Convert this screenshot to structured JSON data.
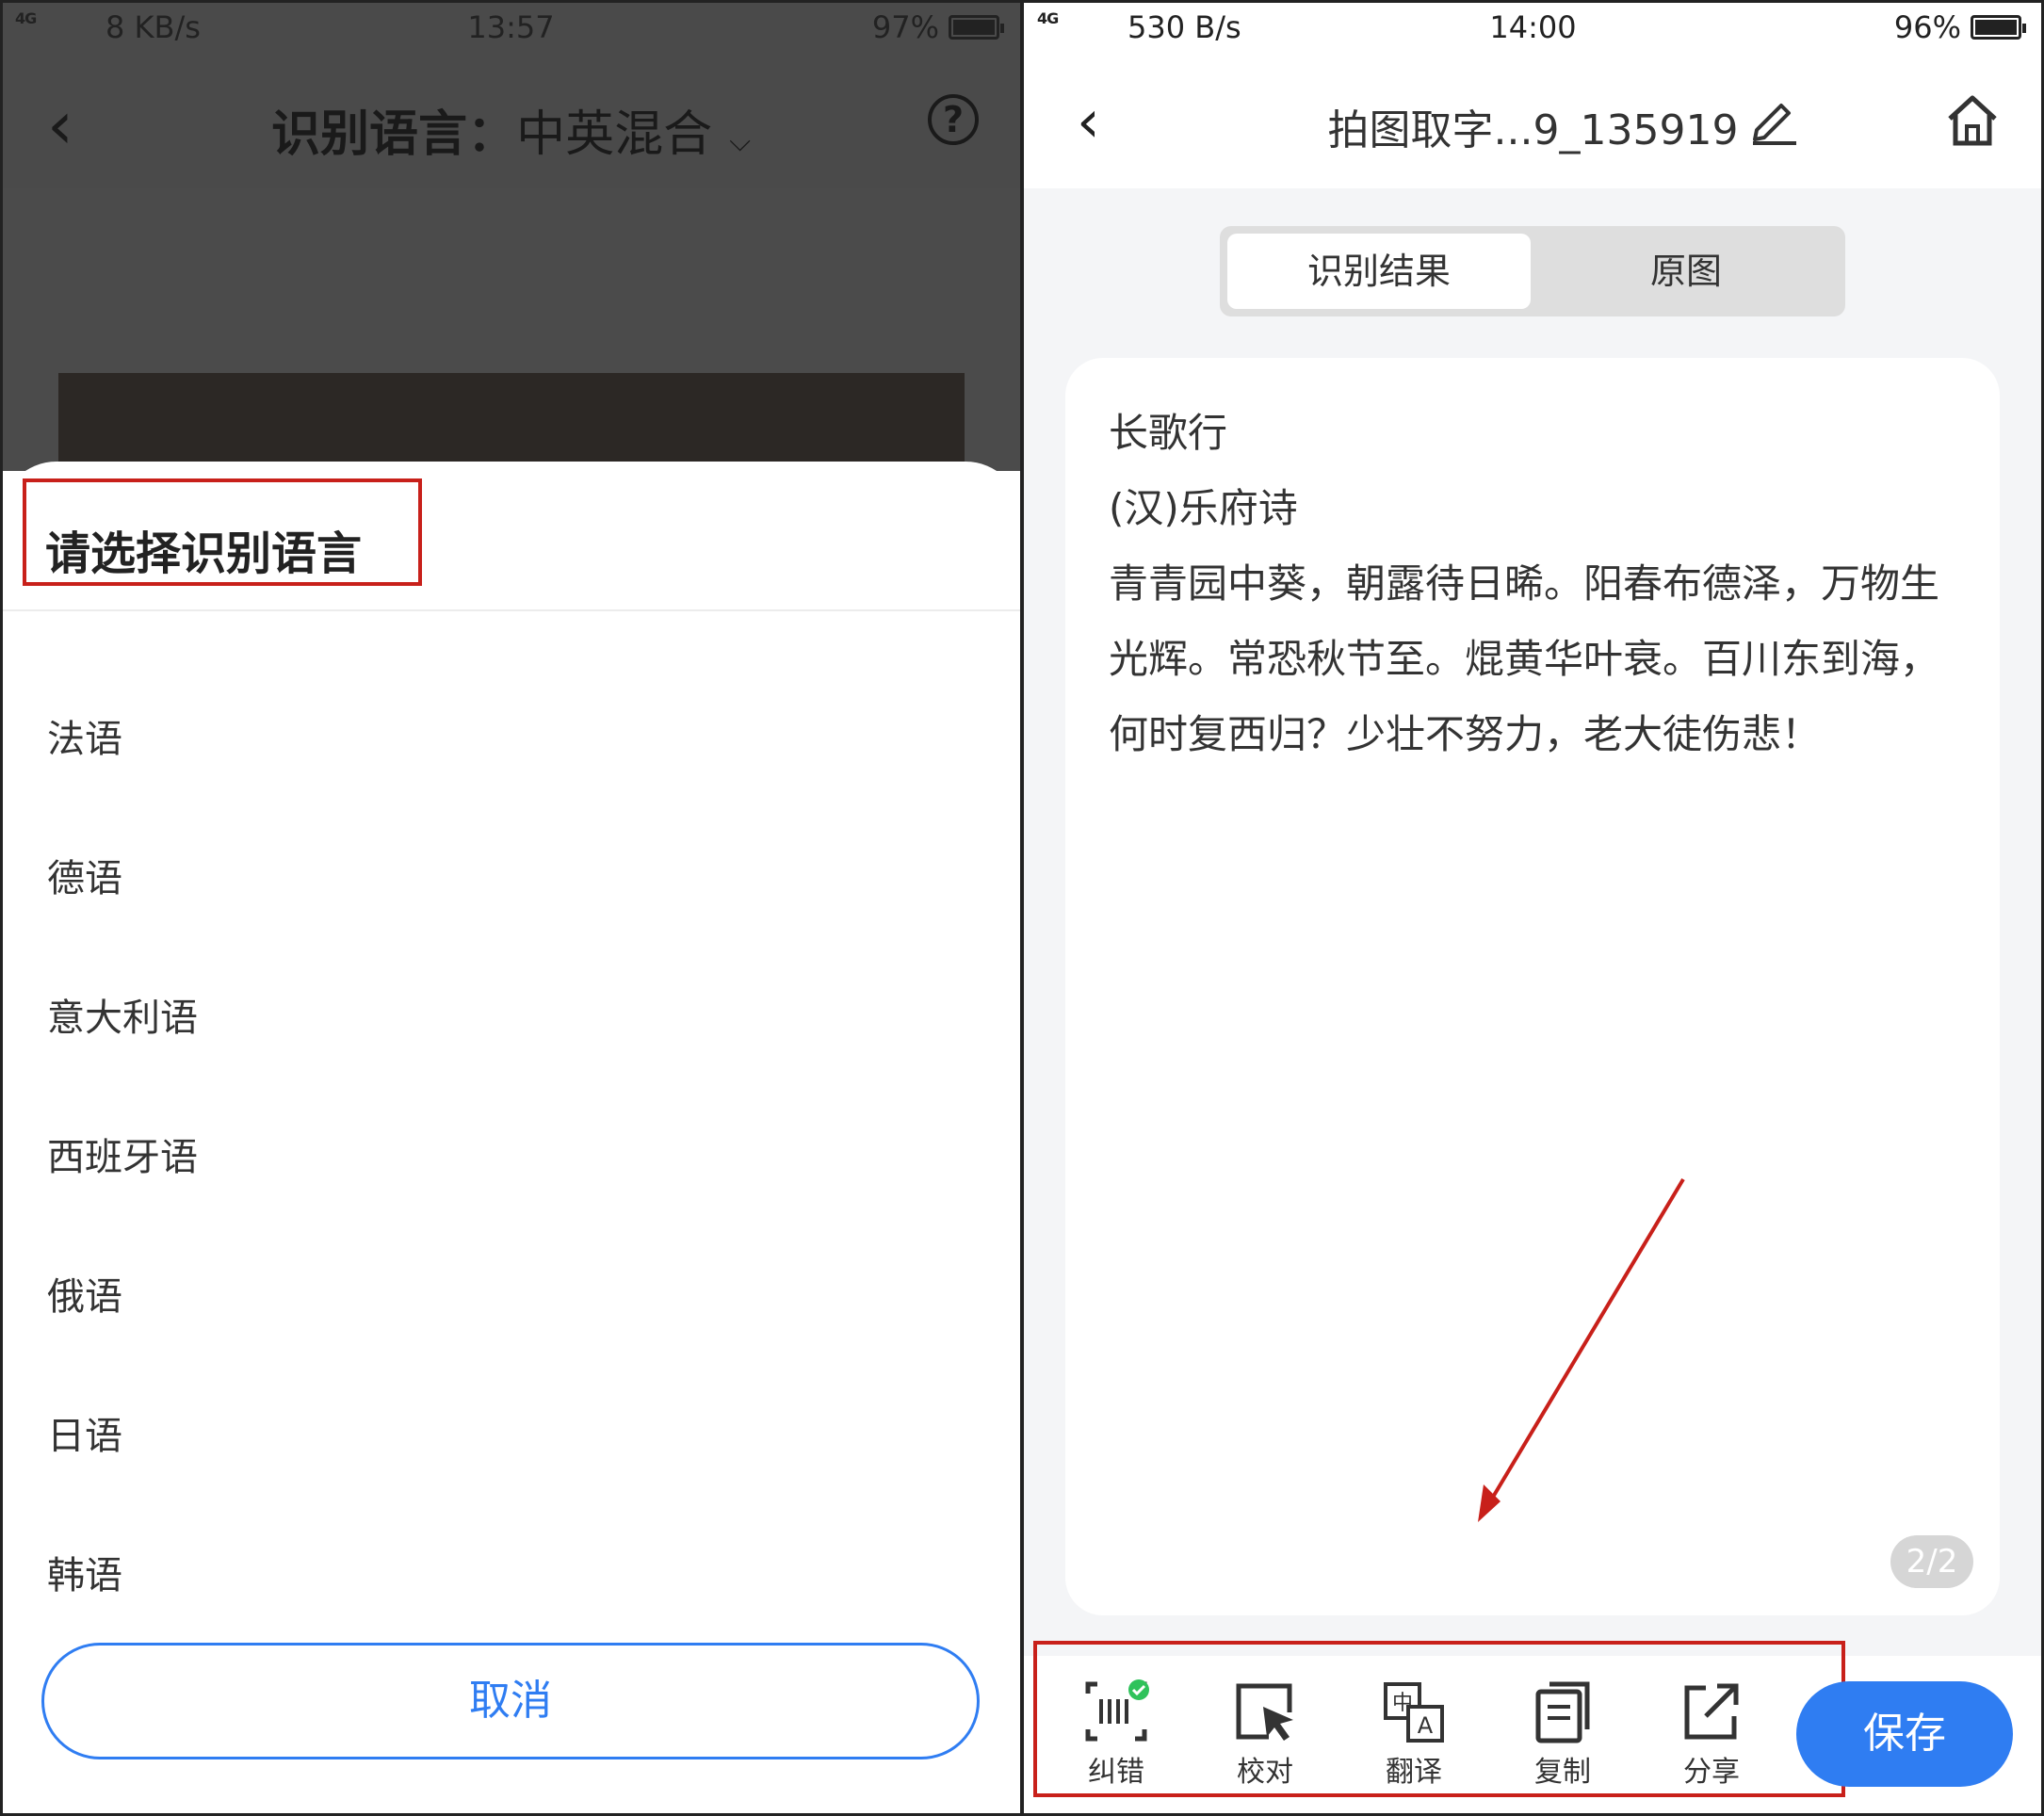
{
  "left": {
    "status": {
      "signal": "4G",
      "speed": "8 KB/s",
      "time": "13:57",
      "battery": "97%"
    },
    "header": {
      "label": "识别语言：",
      "value": "中英混合"
    },
    "sheet": {
      "title": "请选择识别语言",
      "languages": [
        "法语",
        "德语",
        "意大利语",
        "西班牙语",
        "俄语",
        "日语",
        "韩语"
      ],
      "cancel": "取消"
    }
  },
  "right": {
    "status": {
      "signal": "4G",
      "speed": "530 B/s",
      "time": "14:00",
      "battery": "96%"
    },
    "header": {
      "title": "拍图取字...9_135919"
    },
    "tabs": {
      "result": "识别结果",
      "original": "原图"
    },
    "content": {
      "lines": [
        "长歌行",
        "(汉)乐府诗",
        "青青园中葵，朝露待日晞。阳春布德泽，万物生光辉。常恐秋节至。焜黄华叶衰。百川东到海，何时复西归？少壮不努力，老大徒伤悲！"
      ]
    },
    "pager": "2/2",
    "toolbar": [
      "纠错",
      "校对",
      "翻译",
      "复制",
      "分享"
    ],
    "save": "保存"
  },
  "colors": {
    "accent": "#2f7df2",
    "highlight": "#c8201a",
    "check": "#2fc25b"
  }
}
